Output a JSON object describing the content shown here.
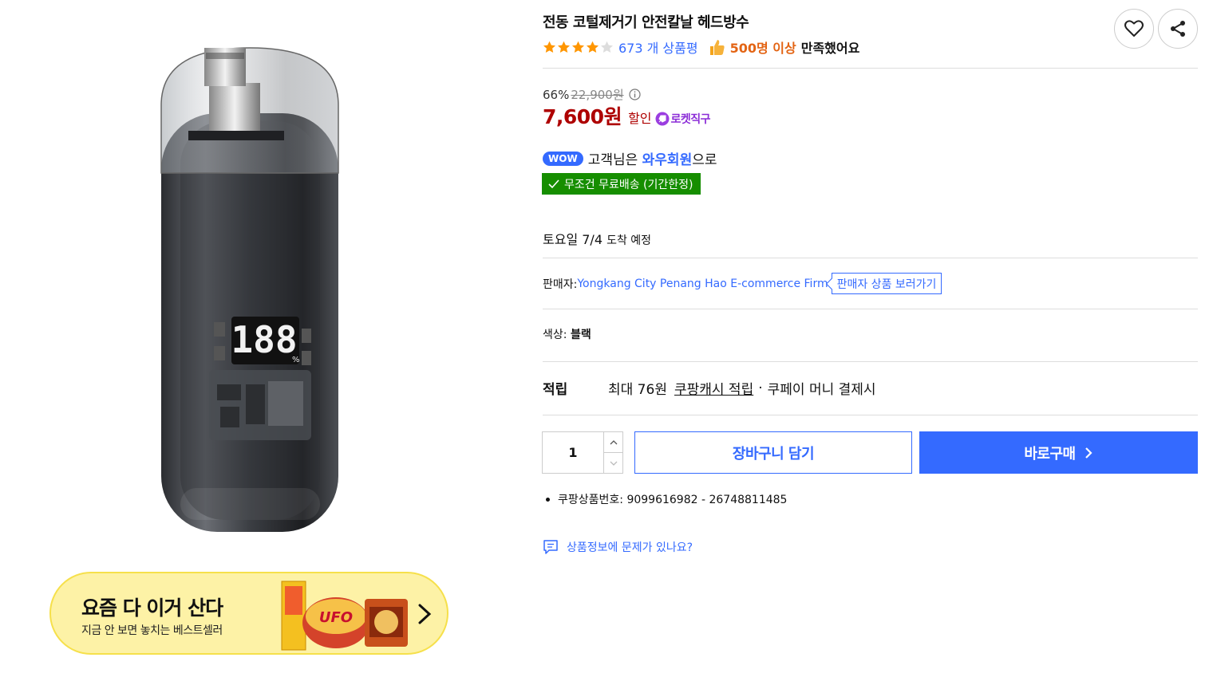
{
  "product": {
    "title": "전동 코털제거기 안전칼날 헤드방수",
    "rating": 4,
    "rating_max": 5,
    "review_count": "673 개 상품평",
    "satisfaction_count": "500명 이상",
    "satisfaction_text": "만족했어요",
    "battery_display": "188"
  },
  "price": {
    "discount_rate": "66%",
    "original_price": "22,900원",
    "sale_price": "7,600원",
    "sale_label": "할인",
    "badge_text": "로켓직구"
  },
  "membership": {
    "wow_badge": "WOW",
    "text_prefix": "고객님은 ",
    "link": "와우회원",
    "text_suffix": "으로",
    "free_shipping": "무조건 무료배송 (기간한정)"
  },
  "delivery": {
    "day": "토요일 7/4",
    "suffix": "도착 예정"
  },
  "seller": {
    "label": "판매자: ",
    "name": "Yongkang City Penang Hao E-commerce Firm",
    "button": "판매자 상품 보러가기"
  },
  "option": {
    "label": "색상: ",
    "value": "블랙"
  },
  "reward": {
    "label": "적립",
    "amount": "최대 76원",
    "link": "쿠팡캐시 적립",
    "dot": "·",
    "suffix": "쿠페이 머니 결제시"
  },
  "purchase": {
    "quantity": "1",
    "cart_label": "장바구니 담기",
    "buy_label": "바로구매"
  },
  "product_number": "쿠팡상품번호: 9099616982 - 26748811485",
  "report_link": "상품정보에 문제가 있나요?",
  "banner": {
    "title": "요즘 다 이거 산다",
    "subtitle": "지금 안 보면 놓치는 베스트셀러"
  },
  "colors": {
    "accent_blue": "#346aff",
    "price_red": "#ae0000",
    "ship_green": "#168e00",
    "rocket_purple": "#8b2cd7",
    "satisfaction_orange": "#e36414",
    "banner_yellow": "#fdf2a6"
  },
  "icons": [
    "heart-icon",
    "share-icon",
    "star-icon",
    "thumbs-up-icon",
    "info-icon",
    "rocket-icon",
    "check-icon",
    "chevron-up-icon",
    "chevron-down-icon",
    "chevron-right-icon",
    "comment-icon"
  ]
}
